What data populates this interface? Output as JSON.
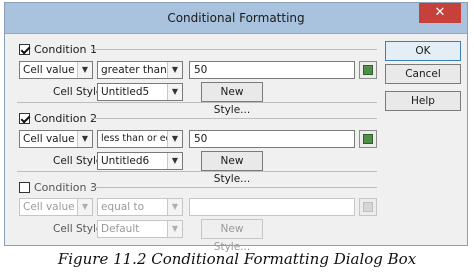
{
  "window": {
    "title": "Conditional Formatting",
    "close_glyph": "✕"
  },
  "conditions": [
    {
      "label": "Condition 1",
      "checked": true,
      "type": "Cell value is",
      "operator": "greater than",
      "value": "50",
      "cell_style_label": "Cell Style",
      "cell_style": "Untitled5",
      "new_style_label": "New Style...",
      "enabled": true
    },
    {
      "label": "Condition 2",
      "checked": true,
      "type": "Cell value is",
      "operator": "less than or equal to",
      "value": "50",
      "cell_style_label": "Cell Style",
      "cell_style": "Untitled6",
      "new_style_label": "New Style...",
      "enabled": true
    },
    {
      "label": "Condition 3",
      "checked": false,
      "type": "Cell value is",
      "operator": "equal to",
      "value": "",
      "cell_style_label": "Cell Style",
      "cell_style": "Default",
      "new_style_label": "New Style...",
      "enabled": false
    }
  ],
  "buttons": {
    "ok": "OK",
    "cancel": "Cancel",
    "help": "Help"
  },
  "icons": {
    "dropdown": "chevron-down-icon",
    "picker": "shrink-icon"
  },
  "caption": "Figure 11.2 Conditional Formatting Dialog Box"
}
